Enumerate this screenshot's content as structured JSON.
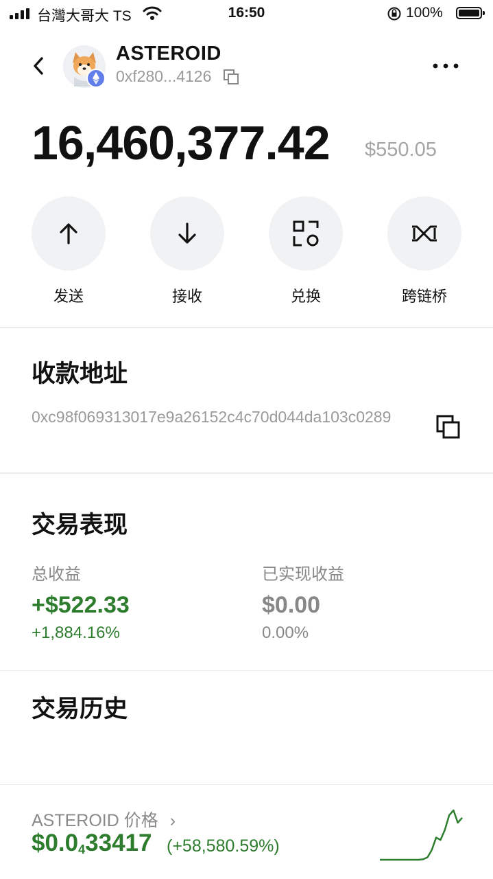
{
  "status_bar": {
    "carrier": "台灣大哥大 TS",
    "time": "16:50",
    "battery": "100%"
  },
  "header": {
    "token_name": "ASTEROID",
    "short_address": "0xf280...4126",
    "back_icon": "chevron-left-icon",
    "more_icon": "more-horizontal-icon",
    "chain_badge_color": "#627eea"
  },
  "balance": {
    "amount": "16,460,377.42",
    "usd": "$550.05"
  },
  "actions": [
    {
      "label": "发送",
      "icon": "arrow-up-icon"
    },
    {
      "label": "接收",
      "icon": "arrow-down-icon"
    },
    {
      "label": "兑换",
      "icon": "swap-icon"
    },
    {
      "label": "跨链桥",
      "icon": "bridge-icon"
    }
  ],
  "receive": {
    "title": "收款地址",
    "address": "0xc98f069313017e9a26152c4c70d044da103c0289"
  },
  "performance": {
    "title": "交易表现",
    "total_label": "总收益",
    "total_value": "+$522.33",
    "total_pct": "+1,884.16%",
    "realized_label": "已实现收益",
    "realized_value": "$0.00",
    "realized_pct": "0.00%",
    "positive_color": "#2e7d2e"
  },
  "history": {
    "title": "交易历史"
  },
  "price": {
    "label": "ASTEROID 价格",
    "chevron": "›",
    "value_prefix": "$0.0",
    "value_zero_count": "4",
    "value_digits": "33417",
    "change": "(+58,580.59%)",
    "sparkline": [
      0,
      0,
      0,
      0,
      0,
      0,
      0,
      0,
      0,
      0,
      0.01,
      0.05,
      0.2,
      0.45,
      0.4,
      0.6,
      0.9,
      1.0,
      0.75,
      0.85
    ]
  }
}
